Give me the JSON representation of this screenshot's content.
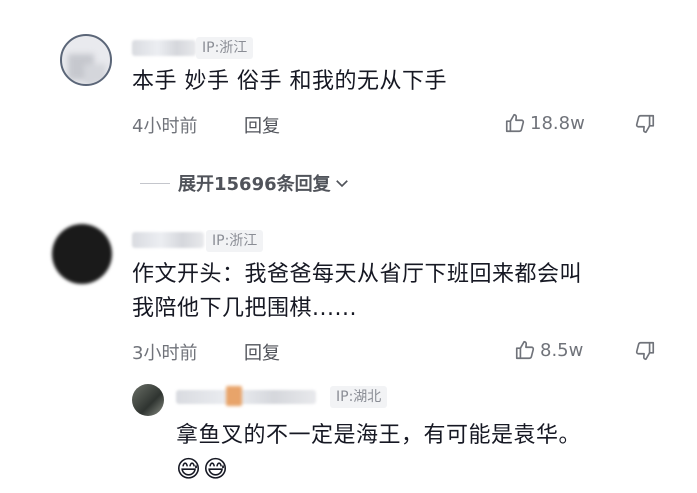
{
  "comments": [
    {
      "ip": "IP:浙江",
      "text": "本手 妙手 俗手 和我的无从下手",
      "time": "4小时前",
      "reply_label": "回复",
      "likes": "18.8w",
      "expand_label": "展开15696条回复"
    },
    {
      "ip": "IP:浙江",
      "text_line1": "作文开头：我爸爸每天从省厅下班回来都会叫",
      "text_line2": "我陪他下几把围棋......",
      "time": "3小时前",
      "reply_label": "回复",
      "likes": "8.5w",
      "sub_reply": {
        "ip": "IP:湖北",
        "text": "拿鱼叉的不一定是海王，有可能是袁华。",
        "emoji": [
          "😅",
          "😅"
        ]
      }
    }
  ],
  "icons": {
    "like": "thumbs-up-icon",
    "dislike": "thumbs-down-icon",
    "expand": "chevron-down-icon"
  }
}
